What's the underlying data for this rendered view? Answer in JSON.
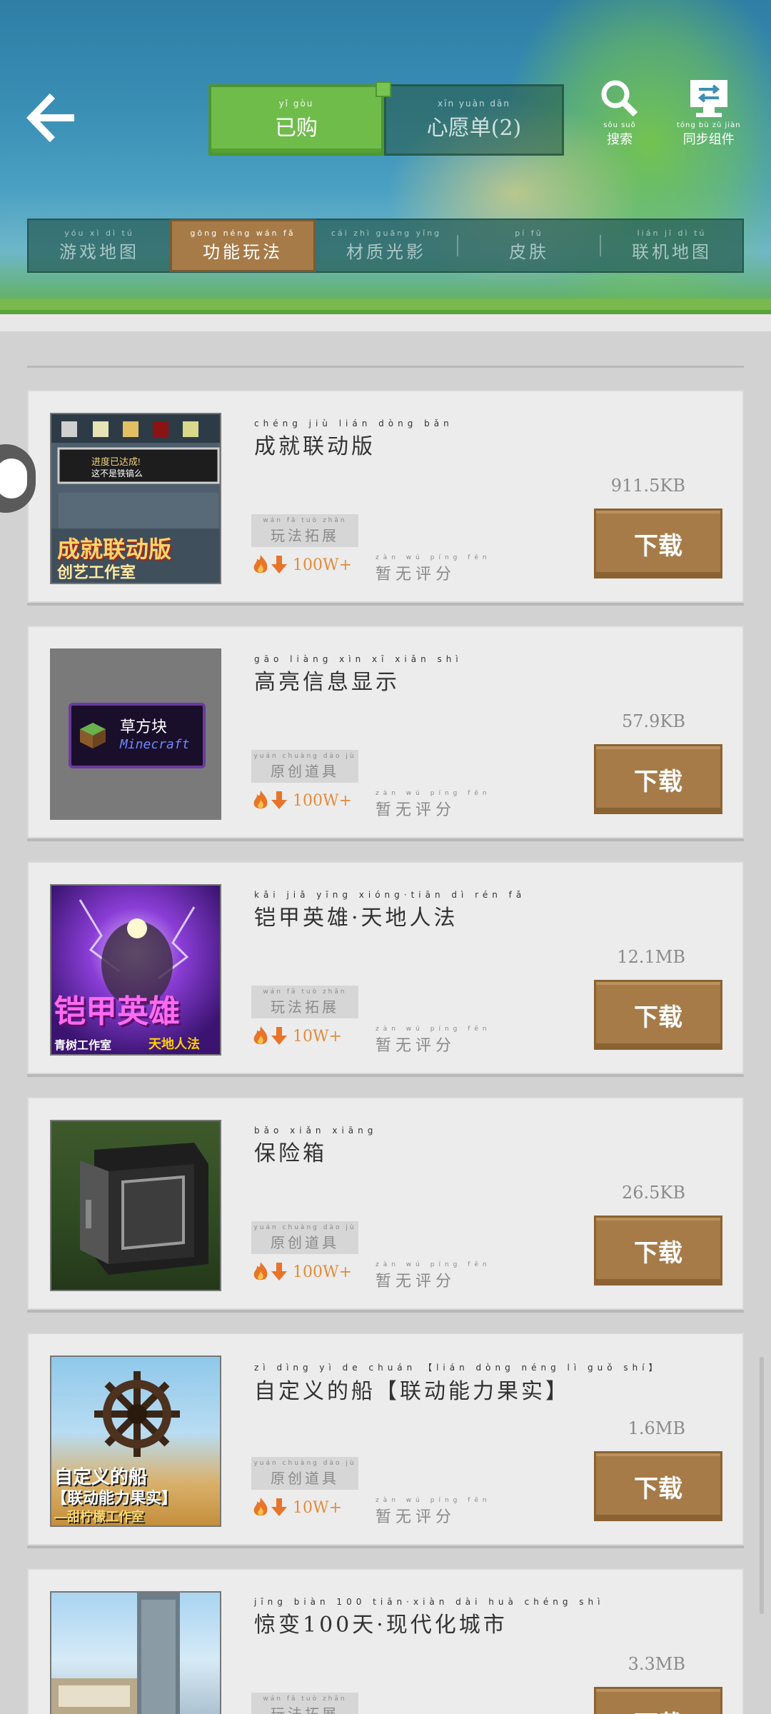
{
  "header": {
    "toggle": {
      "bought": {
        "pinyin": "yǐ gòu",
        "label": "已购"
      },
      "wishlist": {
        "pinyin": "xīn yuàn dān",
        "label": "心愿单(2)"
      }
    },
    "search": {
      "pinyin": "sōu suǒ",
      "label": "搜索"
    },
    "sync": {
      "pinyin": "tóng bù zǔ jiàn",
      "label": "同步组件"
    },
    "tabs": [
      {
        "pinyin": "yóu xì dì tú",
        "label": "游戏地图",
        "active": false
      },
      {
        "pinyin": "gōng néng wán fǎ",
        "label": "功能玩法",
        "active": true
      },
      {
        "pinyin": "cái zhì guāng yǐng",
        "label": "材质光影",
        "active": false
      },
      {
        "pinyin": "pí fū",
        "label": "皮肤",
        "active": false
      },
      {
        "pinyin": "lián jī dì tú",
        "label": "联机地图",
        "active": false
      }
    ]
  },
  "download_label": "下载",
  "items": [
    {
      "title_pinyin": "chéng jiù lián dòng bǎn",
      "title": "成就联动版",
      "tag_pinyin": "wán fǎ tuò zhǎn",
      "tag": "玩法拓展",
      "downloads": "100W+",
      "rating_pinyin": "zàn wú píng fēn",
      "rating": "暂无评分",
      "size": "911.5KB",
      "thumb_text": [
        "进度已达成!",
        "这不是铁镐么",
        "成就联动版",
        "创艺工作室"
      ]
    },
    {
      "title_pinyin": "gāo liàng xìn xī xiǎn shì",
      "title": "高亮信息显示",
      "tag_pinyin": "yuán chuàng dào jù",
      "tag": "原创道具",
      "downloads": "100W+",
      "rating_pinyin": "zàn wú píng fēn",
      "rating": "暂无评分",
      "size": "57.9KB",
      "thumb_text": [
        "草方块",
        "Minecraft"
      ]
    },
    {
      "title_pinyin": "kǎi jiǎ yīng xióng·tiān dì rén fǎ",
      "title": "铠甲英雄·天地人法",
      "tag_pinyin": "wán fǎ tuò zhǎn",
      "tag": "玩法拓展",
      "downloads": "10W+",
      "rating_pinyin": "zàn wú píng fēn",
      "rating": "暂无评分",
      "size": "12.1MB",
      "thumb_text": [
        "铠甲英雄",
        "青树工作室",
        "天地人法"
      ]
    },
    {
      "title_pinyin": "bǎo xiǎn xiāng",
      "title": "保险箱",
      "tag_pinyin": "yuán chuàng dào jù",
      "tag": "原创道具",
      "downloads": "100W+",
      "rating_pinyin": "zàn wú píng fēn",
      "rating": "暂无评分",
      "size": "26.5KB",
      "thumb_text": []
    },
    {
      "title_pinyin": "zì dìng yì de chuán 【lián dòng néng lì guǒ shí】",
      "title": "自定义的船【联动能力果实】",
      "tag_pinyin": "yuán chuàng dào jù",
      "tag": "原创道具",
      "downloads": "10W+",
      "rating_pinyin": "zàn wú píng fēn",
      "rating": "暂无评分",
      "size": "1.6MB",
      "thumb_text": [
        "自定义的船",
        "【联动能力果实】",
        "—甜柠檬工作室"
      ]
    },
    {
      "title_pinyin": "jīng biàn 100 tiān·xiàn dài huà chéng shì",
      "title": "惊变100天·现代化城市",
      "tag_pinyin": "wán fǎ tuò zhǎn",
      "tag": "玩法拓展",
      "downloads": "",
      "rating_pinyin": "",
      "rating": "",
      "size": "3.3MB",
      "thumb_text": []
    }
  ]
}
